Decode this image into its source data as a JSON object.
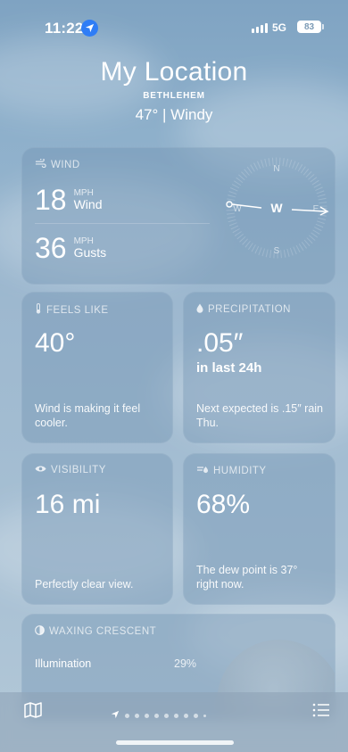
{
  "status_bar": {
    "time": "11:22",
    "network": "5G",
    "battery": "83"
  },
  "header": {
    "location": "My Location",
    "city": "BETHLEHEM",
    "summary": "47° | Windy"
  },
  "wind": {
    "title": "WIND",
    "wind_value": "18",
    "wind_unit": "MPH",
    "wind_label": "Wind",
    "gust_value": "36",
    "gust_unit": "MPH",
    "gust_label": "Gusts",
    "compass": {
      "n": "N",
      "e": "E",
      "s": "S",
      "w": "W",
      "direction": "W"
    }
  },
  "feels_like": {
    "title": "FEELS LIKE",
    "value": "40°",
    "description": "Wind is making it feel cooler."
  },
  "precipitation": {
    "title": "PRECIPITATION",
    "value": ".05″",
    "sub": "in last 24h",
    "description": "Next expected is .15″ rain Thu."
  },
  "visibility": {
    "title": "VISIBILITY",
    "value": "16 mi",
    "description": "Perfectly clear view."
  },
  "humidity": {
    "title": "HUMIDITY",
    "value": "68%",
    "description": "The dew point is 37° right now."
  },
  "moon": {
    "title": "WAXING CRESCENT",
    "illumination_label": "Illumination",
    "illumination_value": "29%"
  },
  "bottom_bar": {
    "page_dots": 10,
    "current_page": 1
  }
}
